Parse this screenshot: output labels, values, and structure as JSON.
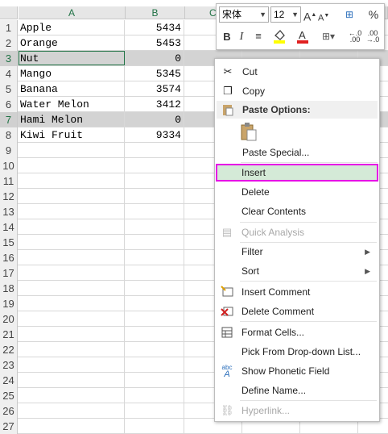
{
  "sheet": {
    "columns": [
      "A",
      "B",
      "C"
    ],
    "rows": [
      {
        "num": "1",
        "a": "Apple",
        "b": "5434"
      },
      {
        "num": "2",
        "a": "Orange",
        "b": "5453"
      },
      {
        "num": "3",
        "a": "Nut",
        "b": "0"
      },
      {
        "num": "4",
        "a": "Mango",
        "b": "5345"
      },
      {
        "num": "5",
        "a": "Banana",
        "b": "3574"
      },
      {
        "num": "6",
        "a": "Water Melon",
        "b": "3412"
      },
      {
        "num": "7",
        "a": "Hami Melon",
        "b": "0"
      },
      {
        "num": "8",
        "a": "Kiwi Fruit",
        "b": "9334"
      },
      {
        "num": "9",
        "a": "",
        "b": ""
      },
      {
        "num": "10",
        "a": "",
        "b": ""
      },
      {
        "num": "11",
        "a": "",
        "b": ""
      },
      {
        "num": "12",
        "a": "",
        "b": ""
      },
      {
        "num": "13",
        "a": "",
        "b": ""
      },
      {
        "num": "14",
        "a": "",
        "b": ""
      },
      {
        "num": "15",
        "a": "",
        "b": ""
      },
      {
        "num": "16",
        "a": "",
        "b": ""
      },
      {
        "num": "17",
        "a": "",
        "b": ""
      },
      {
        "num": "18",
        "a": "",
        "b": ""
      },
      {
        "num": "19",
        "a": "",
        "b": ""
      },
      {
        "num": "20",
        "a": "",
        "b": ""
      },
      {
        "num": "21",
        "a": "",
        "b": ""
      },
      {
        "num": "22",
        "a": "",
        "b": ""
      },
      {
        "num": "23",
        "a": "",
        "b": ""
      },
      {
        "num": "24",
        "a": "",
        "b": ""
      },
      {
        "num": "25",
        "a": "",
        "b": ""
      },
      {
        "num": "26",
        "a": "",
        "b": ""
      },
      {
        "num": "27",
        "a": "",
        "b": ""
      }
    ]
  },
  "mini_toolbar": {
    "font_name": "宋体",
    "font_size": "12",
    "grow_font": "A",
    "shrink_font": "A",
    "bold": "B",
    "italic": "I",
    "percent": "%"
  },
  "menu": {
    "cut": "Cut",
    "copy": "Copy",
    "paste_options": "Paste Options:",
    "paste_special": "Paste Special...",
    "insert": "Insert",
    "delete": "Delete",
    "clear_contents": "Clear Contents",
    "quick_analysis": "Quick Analysis",
    "filter": "Filter",
    "sort": "Sort",
    "insert_comment": "Insert Comment",
    "delete_comment": "Delete Comment",
    "format_cells": "Format Cells...",
    "pick_list": "Pick From Drop-down List...",
    "phonetic": "Show Phonetic Field",
    "define_name": "Define Name...",
    "hyperlink": "Hyperlink..."
  },
  "colors": {
    "highlight_border": "#e600e6",
    "selected_row": "#d3d3d3",
    "header_green": "#217346"
  }
}
